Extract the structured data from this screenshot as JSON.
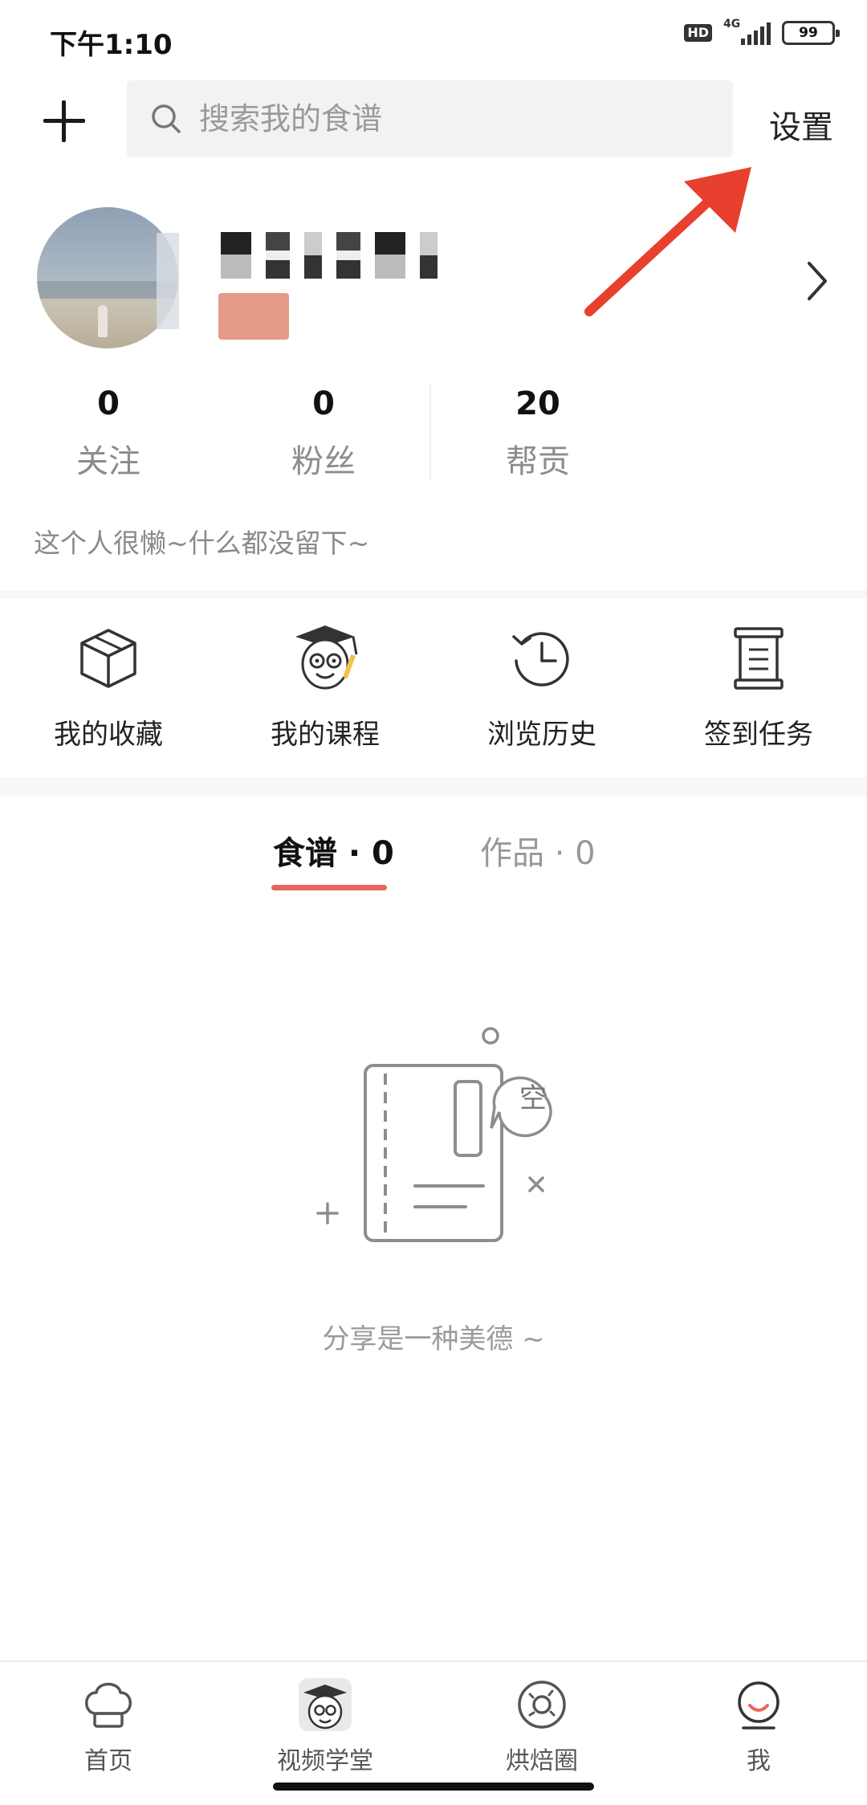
{
  "status_bar": {
    "time": "下午1:10",
    "hd": "HD",
    "network": "4G",
    "battery": "99"
  },
  "top_bar": {
    "search_placeholder": "搜索我的食谱",
    "settings_label": "设置"
  },
  "stats": [
    {
      "value": "0",
      "label": "关注"
    },
    {
      "value": "0",
      "label": "粉丝"
    },
    {
      "value": "20",
      "label": "帮贡"
    }
  ],
  "bio": "这个人很懒~什么都没留下~",
  "quick_menu": [
    {
      "label": "我的收藏",
      "icon": "box-icon"
    },
    {
      "label": "我的课程",
      "icon": "graduate-mascot-icon"
    },
    {
      "label": "浏览历史",
      "icon": "history-clock-icon"
    },
    {
      "label": "签到任务",
      "icon": "scroll-task-icon"
    }
  ],
  "tabs": [
    {
      "label": "食谱 · 0",
      "active": true
    },
    {
      "label": "作品 · 0",
      "active": false
    }
  ],
  "empty_state": {
    "badge": "空",
    "text": "分享是一种美德 ~"
  },
  "bottom_nav": [
    {
      "label": "首页",
      "icon": "chef-hat-icon"
    },
    {
      "label": "视频学堂",
      "icon": "mascot-icon"
    },
    {
      "label": "烘焙圈",
      "icon": "donut-icon"
    },
    {
      "label": "我",
      "icon": "smile-face-icon"
    }
  ],
  "colors": {
    "accent": "#e5695b",
    "annotation_arrow": "#e8402f",
    "muted_text": "#999999"
  }
}
